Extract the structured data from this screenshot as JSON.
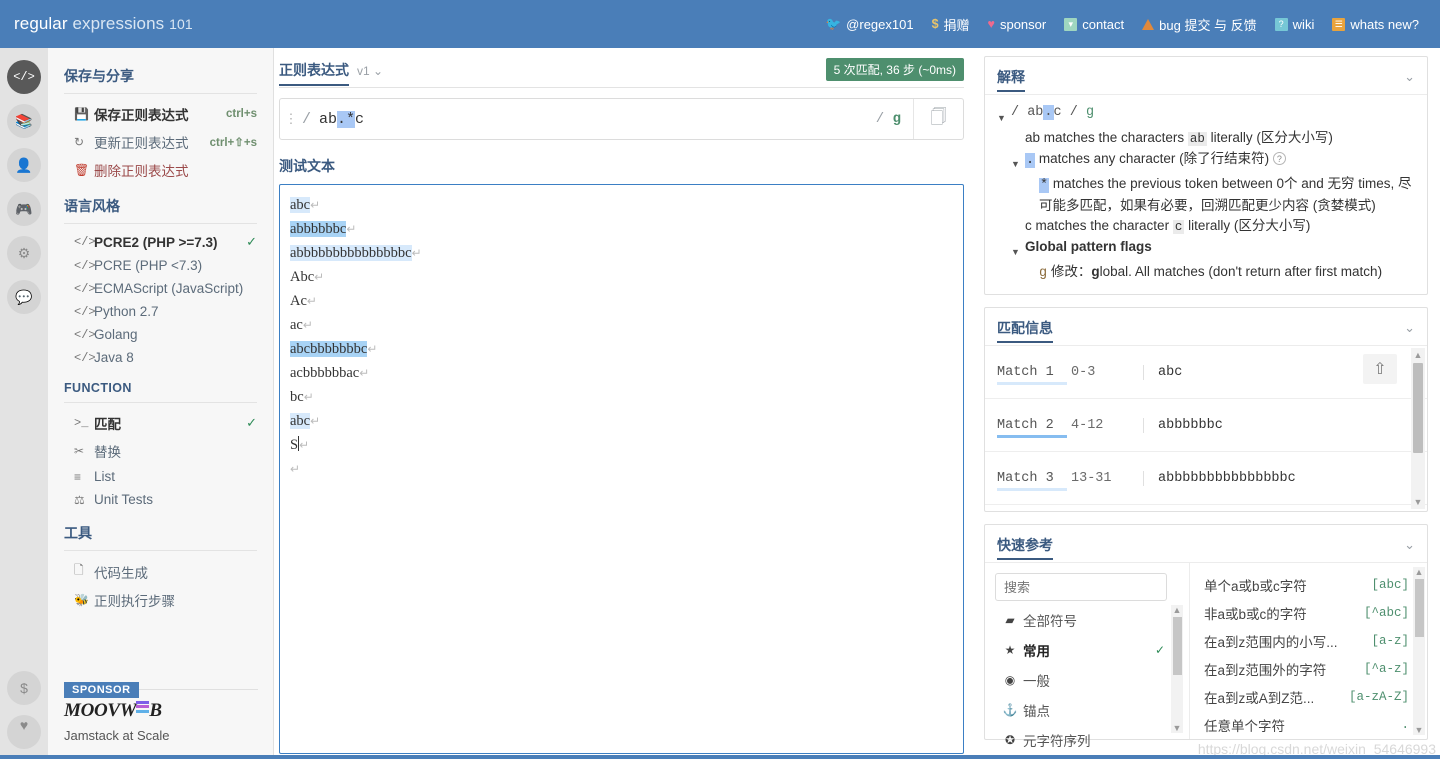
{
  "brand": {
    "word1": "regular",
    "word2": "expressions",
    "num": "101"
  },
  "topnav": [
    {
      "icon": "twitter-icon",
      "label": "@regex101"
    },
    {
      "icon": "dollar-icon",
      "label": "捐赠"
    },
    {
      "icon": "heart-icon",
      "label": "sponsor"
    },
    {
      "icon": "mail-icon",
      "label": "contact"
    },
    {
      "icon": "bug-warning-icon",
      "label": "bug 提交 与 反馈"
    },
    {
      "icon": "wiki-icon",
      "label": "wiki"
    },
    {
      "icon": "news-icon",
      "label": "whats new?"
    }
  ],
  "rail": [
    {
      "icon": "code-icon",
      "glyph": "</>",
      "active": true
    },
    {
      "icon": "library-icon",
      "glyph": "▥",
      "active": false
    },
    {
      "icon": "account-icon",
      "glyph": "●",
      "active": false
    },
    {
      "icon": "gamepad-icon",
      "glyph": "▭",
      "active": false
    },
    {
      "icon": "gear-icon",
      "glyph": "✿",
      "active": false
    },
    {
      "icon": "chat-icon",
      "glyph": "▬",
      "active": false
    }
  ],
  "rail_bottom": [
    {
      "icon": "donate-dollar-icon",
      "glyph": "$"
    },
    {
      "icon": "sponsor-heart-icon",
      "glyph": "♥"
    }
  ],
  "sidebar": {
    "save_share": {
      "heading": "保存与分享",
      "items": [
        {
          "icon": "save-icon",
          "glyph": "▤",
          "label": "保存正则表达式",
          "shortcut": "ctrl+s",
          "bold": true
        },
        {
          "icon": "refresh-icon",
          "glyph": "↻",
          "label": "更新正则表达式",
          "shortcut": "ctrl+⇧+s",
          "bold": false
        },
        {
          "icon": "trash-icon",
          "glyph": "🗑",
          "label": "删除正则表达式",
          "shortcut": "",
          "danger": true
        }
      ]
    },
    "flavor": {
      "heading": "语言风格",
      "items": [
        {
          "icon": "code-icon",
          "label": "PCRE2 (PHP >=7.3)",
          "selected": true
        },
        {
          "icon": "code-icon",
          "label": "PCRE (PHP <7.3)",
          "selected": false
        },
        {
          "icon": "code-icon",
          "label": "ECMAScript (JavaScript)",
          "selected": false
        },
        {
          "icon": "code-icon",
          "label": "Python 2.7",
          "selected": false
        },
        {
          "icon": "code-icon",
          "label": "Golang",
          "selected": false
        },
        {
          "icon": "code-icon",
          "label": "Java 8",
          "selected": false
        }
      ]
    },
    "function": {
      "heading": "FUNCTION",
      "items": [
        {
          "icon": "terminal-icon",
          "glyph": ">_",
          "label": "匹配",
          "selected": true
        },
        {
          "icon": "scissors-icon",
          "glyph": "✂",
          "label": "替换",
          "selected": false
        },
        {
          "icon": "list-icon",
          "glyph": "☰",
          "label": "List",
          "selected": false
        },
        {
          "icon": "test-tube-icon",
          "glyph": "▮",
          "label": "Unit Tests",
          "selected": false
        }
      ]
    },
    "tools": {
      "heading": "工具",
      "items": [
        {
          "icon": "code-file-icon",
          "glyph": "▤",
          "label": "代码生成"
        },
        {
          "icon": "bug-icon",
          "glyph": "🐞",
          "label": "正则执行步骤"
        }
      ]
    },
    "sponsor": {
      "tag": "SPONSOR",
      "name_left": "MOOVW",
      "name_right": "B",
      "tagline": "Jamstack at Scale",
      "bar_colors": [
        "#7d5fe8",
        "#b85fd6",
        "#5fb0e8"
      ]
    }
  },
  "editor": {
    "title": "正则表达式",
    "version": "v1",
    "badge": "5 次匹配, 36 步 (~0ms)",
    "regex_prefix": "ab",
    "regex_highlight": ".*",
    "regex_suffix": "c",
    "delimiter": "/",
    "flags": "g",
    "copy_icon": "copy-icon",
    "test_label": "测试文本",
    "test_lines": [
      {
        "text": "abc",
        "highlight": "light",
        "cursor": false
      },
      {
        "text": "abbbbbbc",
        "highlight": "mid",
        "cursor": false
      },
      {
        "text": "abbbbbbbbbbbbbbbc",
        "highlight": "light",
        "cursor": false
      },
      {
        "text": "Abc",
        "highlight": "none",
        "cursor": false
      },
      {
        "text": "Ac",
        "highlight": "none",
        "cursor": false
      },
      {
        "text": "ac",
        "highlight": "none",
        "cursor": false
      },
      {
        "text": "abcbbbbbbbc",
        "highlight": "mid",
        "cursor": false
      },
      {
        "text": "acbbbbbbac",
        "highlight": "none",
        "cursor": false
      },
      {
        "text": "bc",
        "highlight": "none",
        "cursor": false
      },
      {
        "text": "abc",
        "highlight": "light",
        "cursor": false
      },
      {
        "text": "S",
        "highlight": "none",
        "cursor": true
      },
      {
        "text": "",
        "highlight": "none",
        "cursor": false
      }
    ]
  },
  "explanation": {
    "title": "解释",
    "pattern_prefix": "ab",
    "pattern_token": ".",
    "pattern_suffix": "c",
    "pattern_flag": "g",
    "lines": [
      {
        "type": "plain",
        "indent": 1,
        "parts": [
          {
            "t": "ab matches the characters "
          },
          {
            "t": "ab",
            "s": "lit"
          },
          {
            "t": " literally (区分大小写)"
          }
        ]
      },
      {
        "type": "tri",
        "indent": 1,
        "parts": [
          {
            "t": ".",
            "s": "tok"
          },
          {
            "t": " matches any character (除了行结束符) "
          },
          {
            "t": "?",
            "s": "help"
          }
        ]
      },
      {
        "type": "plain",
        "indent": 2,
        "parts": [
          {
            "t": "*",
            "s": "tok"
          },
          {
            "t": " matches the previous token between 0个 and 无穷 times, 尽可能多匹配，如果有必要，回溯匹配更少内容 (贪婪模式)"
          }
        ]
      },
      {
        "type": "plain",
        "indent": 1,
        "parts": [
          {
            "t": "c matches the character "
          },
          {
            "t": "c",
            "s": "lit"
          },
          {
            "t": " literally (区分大小写)"
          }
        ]
      },
      {
        "type": "tri-bold",
        "indent": 1,
        "parts": [
          {
            "t": "Global pattern flags"
          }
        ]
      },
      {
        "type": "plain",
        "indent": 2,
        "parts": [
          {
            "t": "g",
            "s": "flag"
          },
          {
            "t": " 修改："
          },
          {
            "t": "g",
            "s": "bold"
          },
          {
            "t": "lobal. All matches (don't return after first match)"
          }
        ]
      }
    ]
  },
  "match_info": {
    "title": "匹配信息",
    "share_icon": "share-icon",
    "rows": [
      {
        "name": "Match 1",
        "range": "0-3",
        "value": "abc",
        "accent": "light"
      },
      {
        "name": "Match 2",
        "range": "4-12",
        "value": "abbbbbbc",
        "accent": "mid"
      },
      {
        "name": "Match 3",
        "range": "13-31",
        "value": "abbbbbbbbbbbbbbbc",
        "accent": "light"
      }
    ]
  },
  "quick_ref": {
    "title": "快速参考",
    "search_placeholder": "搜索",
    "categories": [
      {
        "icon": "all-tokens-icon",
        "glyph": "▰",
        "label": "全部符号",
        "selected": false
      },
      {
        "icon": "star-icon",
        "glyph": "★",
        "label": "常用",
        "selected": true
      },
      {
        "icon": "general-icon",
        "glyph": "◉",
        "label": "一般",
        "selected": false
      },
      {
        "icon": "anchor-icon",
        "glyph": "⚓",
        "label": "锚点",
        "selected": false
      },
      {
        "icon": "meta-sequence-icon",
        "glyph": "✪",
        "label": "元字符序列",
        "selected": false
      }
    ],
    "entries": [
      {
        "label": "单个a或b或c字符",
        "code": "[abc]"
      },
      {
        "label": "非a或b或c的字符",
        "code": "[^abc]"
      },
      {
        "label": "在a到z范围内的小写...",
        "code": "[a-z]"
      },
      {
        "label": "在a到z范围外的字符",
        "code": "[^a-z]"
      },
      {
        "label": "在a到z或A到Z范...",
        "code": "[a-zA-Z]"
      },
      {
        "label": "任意单个字符",
        "code": "."
      }
    ]
  },
  "watermark": "https://blog.csdn.net/weixin_54646993"
}
